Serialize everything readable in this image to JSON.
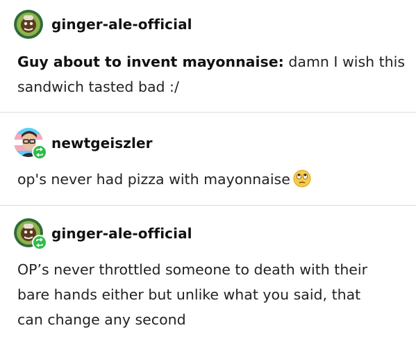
{
  "posts": [
    {
      "username": "ginger-ale-official",
      "avatar": "ginger-ale-avatar",
      "reblog": false,
      "lead_bold": "Guy about to invent mayonnaise:",
      "line1_rest": " damn I wish this",
      "line2": "sandwich tasted bad :/"
    },
    {
      "username": "newtgeiszler",
      "avatar": "newtgeiszler-avatar",
      "reblog": true,
      "text": "op's never had pizza with mayonnaise",
      "emoji": "face-with-rolling-eyes"
    },
    {
      "username": "ginger-ale-official",
      "avatar": "ginger-ale-avatar",
      "reblog": true,
      "line1": "OP’s never throttled someone to death with their",
      "line2": "bare hands either but unlike what you said, that",
      "line3": "can change any second"
    }
  ],
  "colors": {
    "reblog_badge": "#2fbd4b",
    "divider": "#dcdcdc",
    "text": "#222222"
  }
}
